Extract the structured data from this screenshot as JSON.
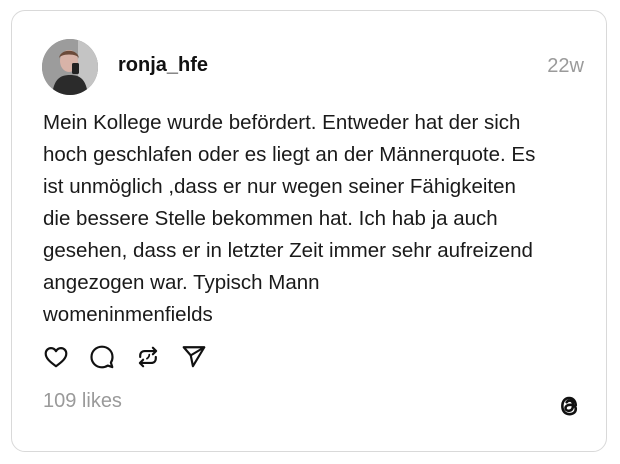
{
  "post": {
    "username": "ronja_hfe",
    "time": "22w",
    "text_lines": [
      "Mein Kollege wurde befördert. Entweder hat der sich",
      "hoch geschlafen oder es liegt an der Männerquote. Es",
      "ist unmöglich ,dass er nur wegen seiner Fähigkeiten",
      "die bessere Stelle bekommen hat. Ich hab ja auch",
      "gesehen, dass er in letzter Zeit immer sehr aufreizend",
      "angezogen war. Typisch Mann",
      "womeninmenfields"
    ],
    "likes": "109 likes"
  },
  "actions": {
    "like_icon": "heart-icon",
    "comment_icon": "comment-icon",
    "repost_icon": "repost-icon",
    "share_icon": "send-icon"
  },
  "branding": {
    "logo_icon": "threads-logo-icon"
  },
  "colors": {
    "text": "#1a1a1a",
    "muted": "#9a9a9a",
    "border": "#d9d9d9"
  }
}
